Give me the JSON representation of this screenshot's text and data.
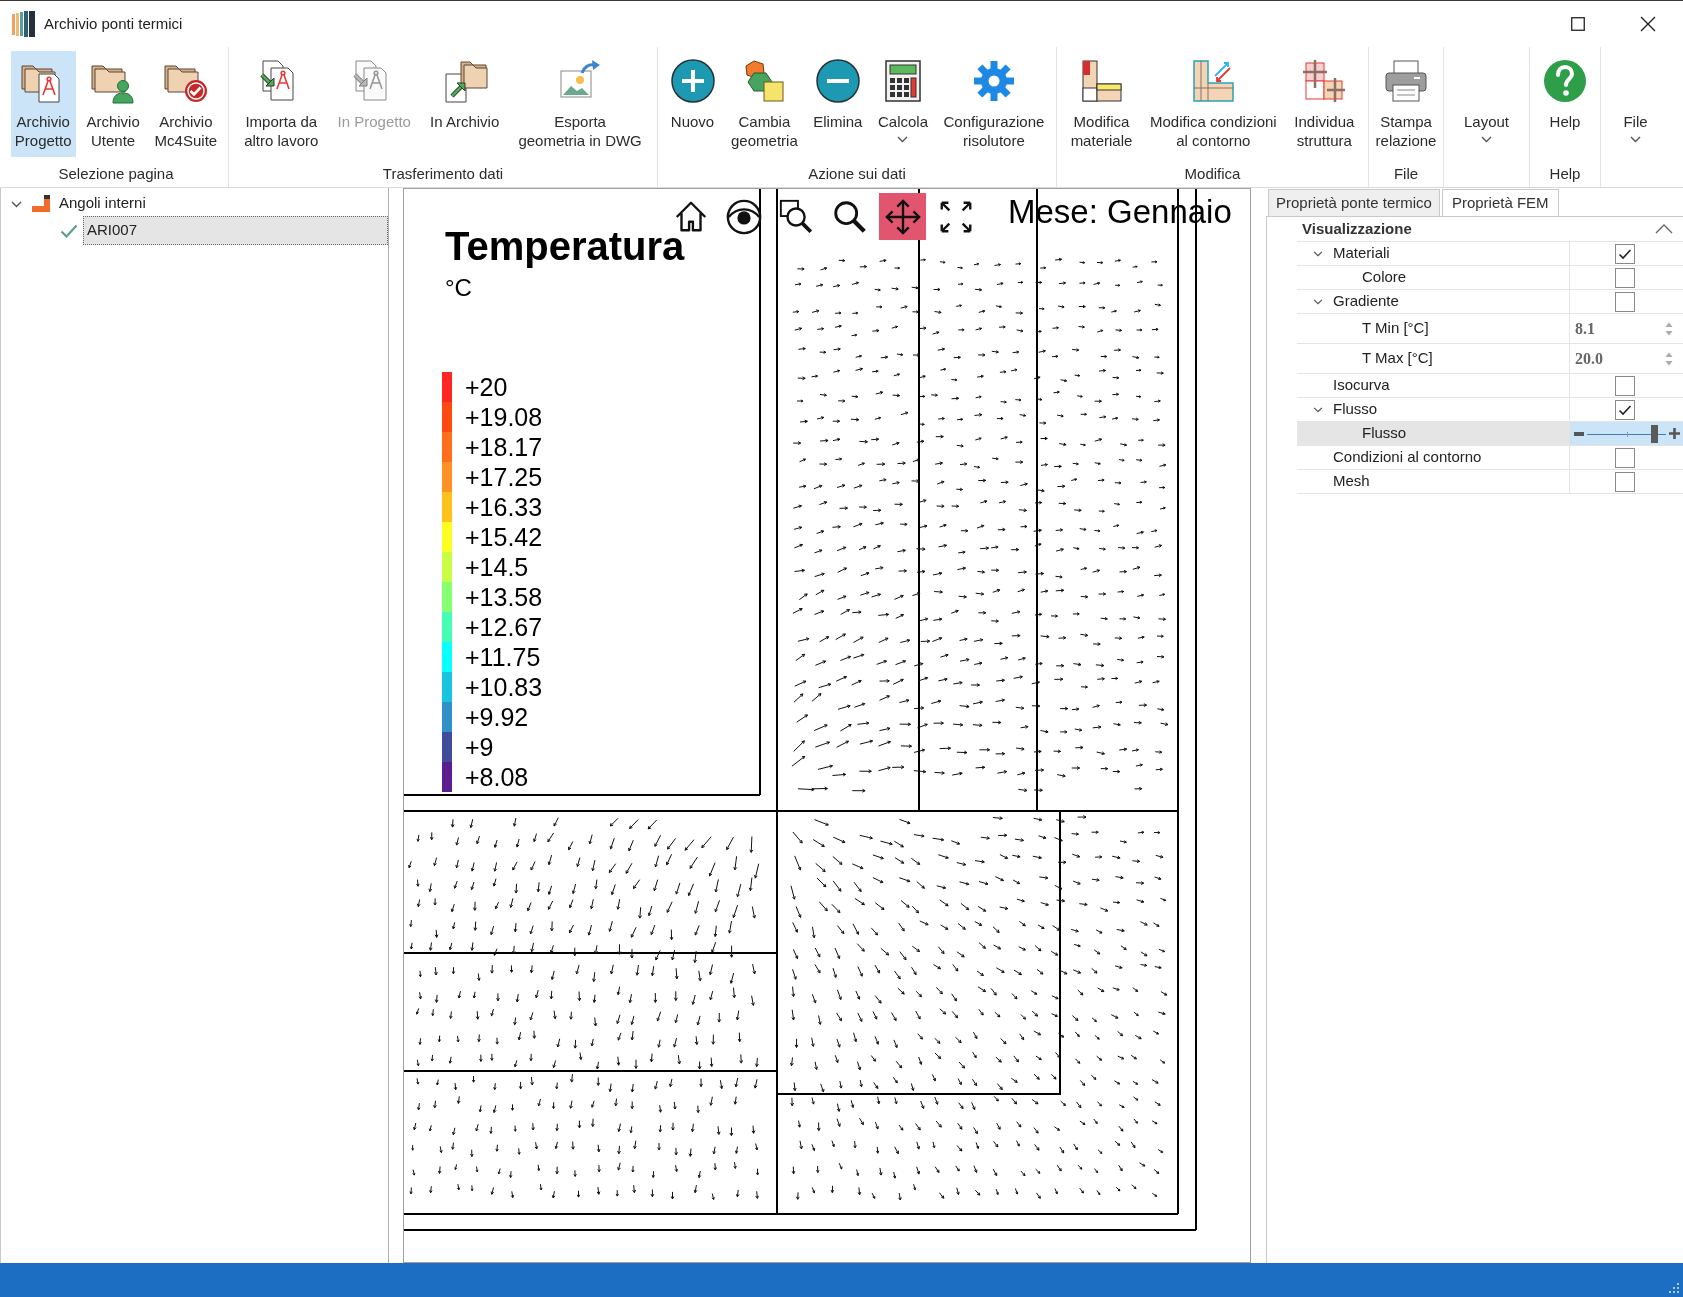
{
  "window": {
    "title": "Archivio ponti termici"
  },
  "ribbon": {
    "groups": [
      {
        "label": "Selezione pagina",
        "buttons": [
          {
            "label": "Archivio\nProgetto",
            "selected": true,
            "disabled": false,
            "dropdown": false
          },
          {
            "label": "Archivio\nUtente",
            "selected": false,
            "disabled": false,
            "dropdown": false
          },
          {
            "label": "Archivio\nMc4Suite",
            "selected": false,
            "disabled": false,
            "dropdown": false
          }
        ]
      },
      {
        "label": "Trasferimento dati",
        "buttons": [
          {
            "label": "Importa da\naltro lavoro",
            "selected": false,
            "disabled": false,
            "dropdown": false
          },
          {
            "label": "In Progetto",
            "selected": false,
            "disabled": true,
            "dropdown": false
          },
          {
            "label": "In Archivio",
            "selected": false,
            "disabled": false,
            "dropdown": false
          },
          {
            "label": "Esporta\ngeometria in DWG",
            "selected": false,
            "disabled": false,
            "dropdown": false
          }
        ]
      },
      {
        "label": "Azione sui dati",
        "buttons": [
          {
            "label": "Nuovo",
            "selected": false,
            "disabled": false,
            "dropdown": false
          },
          {
            "label": "Cambia\ngeometria",
            "selected": false,
            "disabled": false,
            "dropdown": false
          },
          {
            "label": "Elimina",
            "selected": false,
            "disabled": false,
            "dropdown": false
          },
          {
            "label": "Calcola",
            "selected": false,
            "disabled": false,
            "dropdown": true
          },
          {
            "label": "Configurazione\nrisolutore",
            "selected": false,
            "disabled": false,
            "dropdown": false
          }
        ]
      },
      {
        "label": "Modifica",
        "buttons": [
          {
            "label": "Modifica\nmateriale",
            "selected": false,
            "disabled": false,
            "dropdown": false
          },
          {
            "label": "Modifica condizioni\nal contorno",
            "selected": false,
            "disabled": false,
            "dropdown": false
          },
          {
            "label": "Individua\nstruttura",
            "selected": false,
            "disabled": false,
            "dropdown": false
          }
        ]
      },
      {
        "label": "File",
        "buttons": [
          {
            "label": "Stampa\nrelazione",
            "selected": false,
            "disabled": false,
            "dropdown": false
          }
        ]
      },
      {
        "buttons": [
          {
            "label": "Layout",
            "selected": false,
            "disabled": false,
            "dropdown": true
          }
        ]
      },
      {
        "label": "Help",
        "buttons": [
          {
            "label": "Help",
            "selected": false,
            "disabled": false,
            "dropdown": false
          }
        ]
      },
      {
        "buttons": [
          {
            "label": "File",
            "selected": false,
            "disabled": false,
            "dropdown": true
          }
        ]
      }
    ]
  },
  "tree": [
    {
      "label": "Angoli interni",
      "expanded": true,
      "selected": false,
      "children": [
        {
          "label": "ARI007",
          "selected": true,
          "checked": true
        }
      ]
    }
  ],
  "canvas": {
    "tools": [
      {
        "selected": false
      },
      {
        "selected": false
      },
      {
        "selected": false
      },
      {
        "selected": false
      },
      {
        "selected": true
      },
      {
        "selected": false
      }
    ],
    "month_label": "Mese: Gennaio",
    "legend": {
      "title": "Temperatura",
      "unit": "°C",
      "entries": [
        {
          "label": "+20",
          "color": "#ff2626"
        },
        {
          "label": "+19.08",
          "color": "#ff4a12"
        },
        {
          "label": "+18.17",
          "color": "#ff6e1c"
        },
        {
          "label": "+17.25",
          "color": "#ff9224"
        },
        {
          "label": "+16.33",
          "color": "#ffc21c"
        },
        {
          "label": "+15.42",
          "color": "#ffff22"
        },
        {
          "label": "+14.5",
          "color": "#c8ff44"
        },
        {
          "label": "+13.58",
          "color": "#86ff70"
        },
        {
          "label": "+12.67",
          "color": "#44ffb4"
        },
        {
          "label": "+11.75",
          "color": "#0affff"
        },
        {
          "label": "+10.83",
          "color": "#18c4e0"
        },
        {
          "label": "+9.92",
          "color": "#3090c8"
        },
        {
          "label": "+9",
          "color": "#3e4c9a"
        },
        {
          "label": "+8.08",
          "color": "#5a1e8e"
        }
      ]
    }
  },
  "properties": {
    "tabs": [
      {
        "label": "Proprietà ponte termico",
        "selected": false
      },
      {
        "label": "Proprietà FEM",
        "selected": true
      }
    ],
    "category": {
      "label": "Visualizzazione",
      "expanded": true
    },
    "rows": [
      {
        "label": "Materiali",
        "kind": "checkbox",
        "checked": true,
        "expanded": true,
        "selected": false,
        "children": [
          {
            "label": "Colore",
            "kind": "checkbox",
            "checked": false,
            "selected": false
          }
        ]
      },
      {
        "label": "Gradiente",
        "kind": "checkbox",
        "checked": false,
        "expanded": true,
        "selected": false,
        "children": [
          {
            "label": "T Min [°C]",
            "kind": "number",
            "value": "8.1",
            "selected": false
          },
          {
            "label": "T Max [°C]",
            "kind": "number",
            "value": "20.0",
            "selected": false
          }
        ]
      },
      {
        "label": "Isocurva",
        "kind": "checkbox",
        "checked": false,
        "selected": false
      },
      {
        "label": "Flusso",
        "kind": "checkbox",
        "checked": true,
        "expanded": true,
        "selected": false,
        "children": [
          {
            "label": "Flusso",
            "kind": "slider",
            "level": 0.86,
            "selected": true
          }
        ]
      },
      {
        "label": "Condizioni al contorno",
        "kind": "checkbox",
        "checked": false,
        "selected": false
      },
      {
        "label": "Mesh",
        "kind": "checkbox",
        "checked": false,
        "selected": false
      }
    ]
  }
}
